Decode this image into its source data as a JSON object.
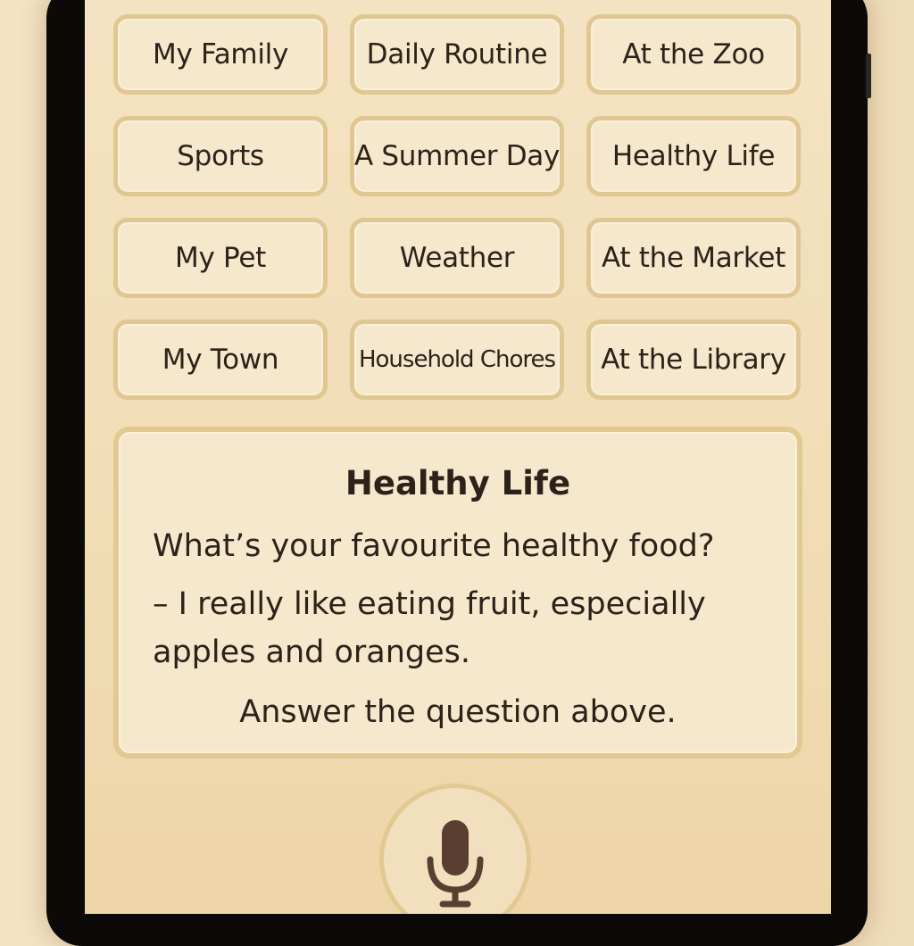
{
  "topics": [
    "My Family",
    "Daily Routine",
    "At the Zoo",
    "Sports",
    "A Summer Day",
    "Healthy Life",
    "My Pet",
    "Weather",
    "At the Market",
    "My Town",
    "Household Chores",
    "At the Library"
  ],
  "card": {
    "title": "Healthy Life",
    "question": "What’s your favourite healthy food?",
    "answer": "– I really like eating fruit, especially apples and oranges.",
    "prompt": "Answer the question above."
  },
  "mic": {
    "icon": "microphone-icon"
  },
  "colors": {
    "background": "#f4e3c3",
    "border": "#e0c792",
    "text": "#2c221a",
    "mic": "#5a3f30"
  }
}
